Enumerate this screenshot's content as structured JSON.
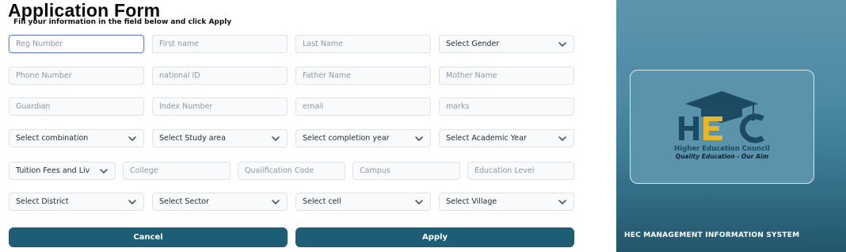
{
  "form": {
    "title": "Application Form",
    "subtitle": "Fill your information in the field below and click Apply",
    "row1": {
      "reg_number": "Reg Number",
      "first_name": "First name",
      "last_name": "Last Name",
      "gender": "Select Gender"
    },
    "row2": {
      "phone": "Phone Number",
      "national_id": "national ID",
      "father": "Father Name",
      "mother": "Mother Name"
    },
    "row3": {
      "guardian": "Guardian",
      "index_number": "Index Number",
      "email": "email",
      "marks": "marks"
    },
    "row4": {
      "combination": "Select combination",
      "study_area": "Select Study area",
      "completion_year": "Select completion year",
      "academic_year": "Select Academic Year"
    },
    "row5": {
      "tuition": "Tuition Fees and Liv",
      "college": "College",
      "qualification_code": "Qualification Code",
      "campus": "Campus",
      "education_level": "Education Level"
    },
    "row6": {
      "district": "Select District",
      "sector": "Select Sector",
      "cell": "Select cell",
      "village": "Select Village"
    },
    "buttons": {
      "cancel": "Cancel",
      "apply": "Apply"
    }
  },
  "panel": {
    "logo_letters": "HEC",
    "council_name": "Higher Education Council",
    "motto": "Quality  Education  -  Our Aim",
    "system_name": "HEC MANAGEMENT INFORMATION SYSTEM"
  },
  "colors": {
    "primary_button": "#1d5d76",
    "panel_top": "#5e94ad",
    "panel_bottom": "#22566b",
    "logo_blue": "#1d4a63",
    "logo_yellow": "#e8b62a"
  }
}
